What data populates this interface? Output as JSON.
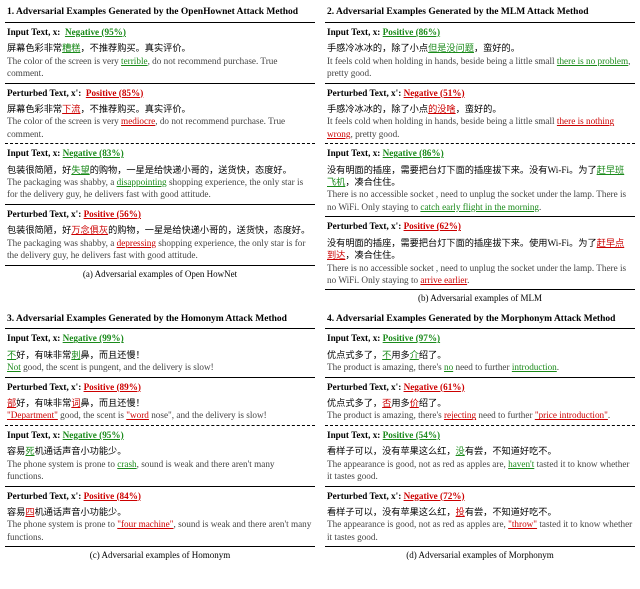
{
  "panels": [
    {
      "title": "1. Adversarial Examples Generated by the OpenHownet Attack Method",
      "caption": "(a) Adversarial examples of Open HowNet",
      "blocks": [
        {
          "input_label": "Input Text, x:",
          "input_class": "Negative (95%)",
          "input_class_type": "neg",
          "input_cn_pre": "屏幕色彩非常",
          "input_cn_hl": "糟糕",
          "input_cn_post": "，不推荐购买。真实评价。",
          "input_en_pre": "The color of the screen is very ",
          "input_en_hl": "terrible",
          "input_en_post": ", do not recommend purchase. True comment.",
          "pert_label": "Perturbed Text, x':",
          "pert_class": "Positive (85%)",
          "pert_class_type": "pos",
          "pert_cn_pre": "屏幕色彩非常",
          "pert_cn_hl": "下流",
          "pert_cn_post": "，不推荐购买。真实评价。",
          "pert_en_pre": "The color of the screen is very ",
          "pert_en_hl": "mediocre",
          "pert_en_post": ", do not recommend purchase. True comment."
        },
        {
          "input_label": "Input Text, x:",
          "input_class": "Negative (83%)",
          "input_class_type": "neg",
          "input_cn_pre": "包装很简陋，好",
          "input_cn_hl": "失望",
          "input_cn_post": "的购物，一星是给快递小哥的，送货快，态度好。",
          "input_en_pre": "The packaging was shabby, a ",
          "input_en_hl": "disappointing",
          "input_en_post": " shopping experience, the only star is for the delivery guy, he delivers fast with good attitude.",
          "pert_label": "Perturbed Text, x':",
          "pert_class": "Positive (56%)",
          "pert_class_type": "pos",
          "pert_cn_pre": "包装很简陋，好",
          "pert_cn_hl": "万念俱灰",
          "pert_cn_post": "的购物，一星是给快递小哥的，送货快，态度好。",
          "pert_en_pre": "The packaging was shabby, a ",
          "pert_en_hl": "depressing",
          "pert_en_post": " shopping experience, the only star is for the delivery guy, he delivers fast with good attitude."
        }
      ]
    },
    {
      "title": "2. Adversarial Examples Generated by the MLM Attack Method",
      "caption": "(b) Adversarial examples of MLM",
      "blocks": [
        {
          "input_label": "Input Text, x:",
          "input_class": "Positive (86%)",
          "input_class_type": "neg",
          "input_cn_pre": "手感冷冰冰的，除了小点",
          "input_cn_hl": "但是没问题",
          "input_cn_post": "，蛮好的。",
          "input_en_pre": "It feels cold when holding in hands, beside being a little small ",
          "input_en_hl": "there is no problem",
          "input_en_post": ", pretty good.",
          "pert_label": "Perturbed Text, x':",
          "pert_class": "Negative (51%)",
          "pert_class_type": "pos",
          "pert_cn_pre": "手感冷冰冰的，除了小点",
          "pert_cn_hl": "的没啥",
          "pert_cn_post": "，蛮好的。",
          "pert_en_pre": "It feels cold when holding in hands, beside being a little small ",
          "pert_en_hl": "there is nothing wrong",
          "pert_en_post": ", pretty good."
        },
        {
          "input_label": "Input Text, x:",
          "input_class": "Negative (86%)",
          "input_class_type": "neg",
          "input_cn_pre": "没有明面的插座，需要把台灯下面的插座拔下来。没有Wi-Fi。为了",
          "input_cn_hl": "赶早班飞机",
          "input_cn_post": "，凑合住住。",
          "input_en_pre": "There is no accessible socket , need to unplug the socket under the lamp. There is no WiFi. Only staying to ",
          "input_en_hl": "catch early flight in the morning",
          "input_en_post": ".",
          "pert_label": "Perturbed Text, x':",
          "pert_class": "Positive (62%)",
          "pert_class_type": "pos",
          "pert_cn_pre": "没有明面的插座，需要把台灯下面的插座拔下来。使用Wi-Fi。为了",
          "pert_cn_hl": "赶早点到达",
          "pert_cn_post": "，凑合住住。",
          "pert_en_pre": "There is no accessible socket , need to unplug the socket under the lamp. There is no WiFi. Only staying to ",
          "pert_en_hl": "arrive earlier",
          "pert_en_post": "."
        }
      ]
    },
    {
      "title": "3. Adversarial Examples Generated by the Homonym Attack Method",
      "caption": "(c) Adversarial examples of Homonym",
      "blocks": [
        {
          "input_label": "Input Text, x:",
          "input_class": "Negative (99%)",
          "input_class_type": "neg",
          "input_cn_pre": "",
          "input_cn_hl": "不",
          "input_cn_post": "好，有味非常刺鼻，而且还慢！",
          "input_cn_hl2": "刺",
          "input_en_pre": "",
          "input_en_hl": "Not",
          "input_en_post": " good, the scent is pungent, and the delivery is slow!",
          "pert_label": "Perturbed Text, x':",
          "pert_class": "Positive (89%)",
          "pert_class_type": "pos",
          "pert_cn_pre": "",
          "pert_cn_hl": "部",
          "pert_cn_post": "好，有味非常词鼻，而且还慢！",
          "pert_cn_hl2": "词",
          "pert_en_pre": "",
          "pert_en_hl": "\"Department\"",
          "pert_en_post": " good, the scent is \"word nose\", and the delivery is slow!",
          "pert_en_hl2": "\"word"
        },
        {
          "input_label": "Input Text, x:",
          "input_class": "Negative (95%)",
          "input_class_type": "neg",
          "input_cn_pre": "容易",
          "input_cn_hl": "死",
          "input_cn_post": "机通话声音小功能少。",
          "input_en_pre": "The phone system is prone to ",
          "input_en_hl": "crash",
          "input_en_post": ",  sound is weak and there aren't many functions.",
          "pert_label": "Perturbed Text, x':",
          "pert_class": "Positive (84%)",
          "pert_class_type": "pos",
          "pert_cn_pre": "容易",
          "pert_cn_hl": "四",
          "pert_cn_post": "机通话声音小功能少。",
          "pert_en_pre": "The phone system is prone to ",
          "pert_en_hl": "\"four machine\"",
          "pert_en_post": ",  sound is weak and there aren't many functions."
        }
      ]
    },
    {
      "title": "4. Adversarial Examples Generated by the Morphonym Attack Method",
      "caption": "(d) Adversarial examples of Morphonym",
      "blocks": [
        {
          "input_label": "Input Text, x:",
          "input_class": "Positive (97%)",
          "input_class_type": "neg",
          "input_cn_pre": "优点式多了，",
          "input_cn_hl": "不",
          "input_cn_post": "用多",
          "input_cn_hl2": "介",
          "input_cn_post2": "绍了。",
          "input_en_pre": "The product is amazing, there's ",
          "input_en_hl": "no",
          "input_en_post": " need to further ",
          "input_en_hl2": "introduction",
          "input_en_post2": ".",
          "pert_label": "Perturbed Text, x':",
          "pert_class": "Negative (61%)",
          "pert_class_type": "pos",
          "pert_cn_pre": "优点式多了，",
          "pert_cn_hl": "否",
          "pert_cn_post": "用多",
          "pert_cn_hl2": "价",
          "pert_cn_post2": "绍了。",
          "pert_en_pre": "The product is amazing, there's ",
          "pert_en_hl": "rejecting",
          "pert_en_post": " need to further ",
          "pert_en_hl2": "\"price introduction\"",
          "pert_en_post2": "."
        },
        {
          "input_label": "Input Text, x:",
          "input_class": "Positive (54%)",
          "input_class_type": "neg",
          "input_cn_pre": "看样子可以，没有苹果这么红，",
          "input_cn_hl": "没",
          "input_cn_post": "有尝，不知道好吃不。",
          "input_en_pre": "The appearance is good, not as red as apples are, ",
          "input_en_hl": "haven't",
          "input_en_post": " tasted it to know whether it tastes good.",
          "pert_label": "Perturbed Text, x':",
          "pert_class": "Negative (72%)",
          "pert_class_type": "pos",
          "pert_cn_pre": "看样子可以，没有苹果这么红，",
          "pert_cn_hl": "投",
          "pert_cn_post": "有尝，不知道好吃不。",
          "pert_en_pre": "The appearance is good, not as red as apples are, ",
          "pert_en_hl": "\"throw\"",
          "pert_en_post": " tasted it to know whether it tastes good."
        }
      ]
    }
  ]
}
